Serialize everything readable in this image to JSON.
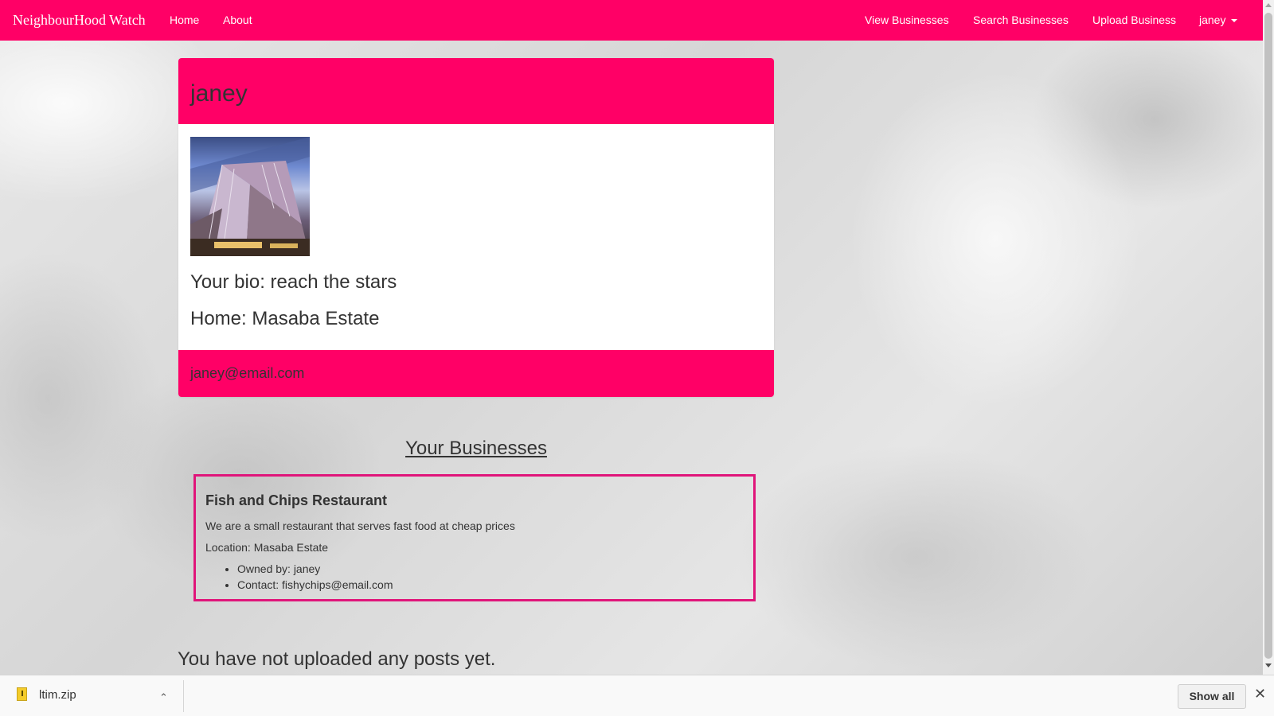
{
  "nav": {
    "brand": "NeighbourHood Watch",
    "home": "Home",
    "about": "About",
    "view_businesses": "View Businesses",
    "search_businesses": "Search Businesses",
    "upload_business": "Upload Business",
    "user": "janey"
  },
  "profile": {
    "username": "janey",
    "bio": "Your bio: reach the stars",
    "home": "Home: Masaba Estate",
    "email": "janey@email.com"
  },
  "businesses": {
    "section_title": "Your Businesses",
    "items": [
      {
        "name": "Fish and Chips Restaurant",
        "description": "We are a small restaurant that serves fast food at cheap prices",
        "location": "Location: Masaba Estate",
        "owner": "Owned by: janey",
        "contact": "Contact: fishychips@email.com"
      }
    ]
  },
  "posts": {
    "empty_message": "You have not uploaded any posts yet."
  },
  "download_bar": {
    "file_name": "ltim.zip",
    "show_all": "Show all",
    "file_icon": "zip-file-icon"
  },
  "colors": {
    "brand": "#ff0066",
    "card_border": "#e0157a"
  }
}
